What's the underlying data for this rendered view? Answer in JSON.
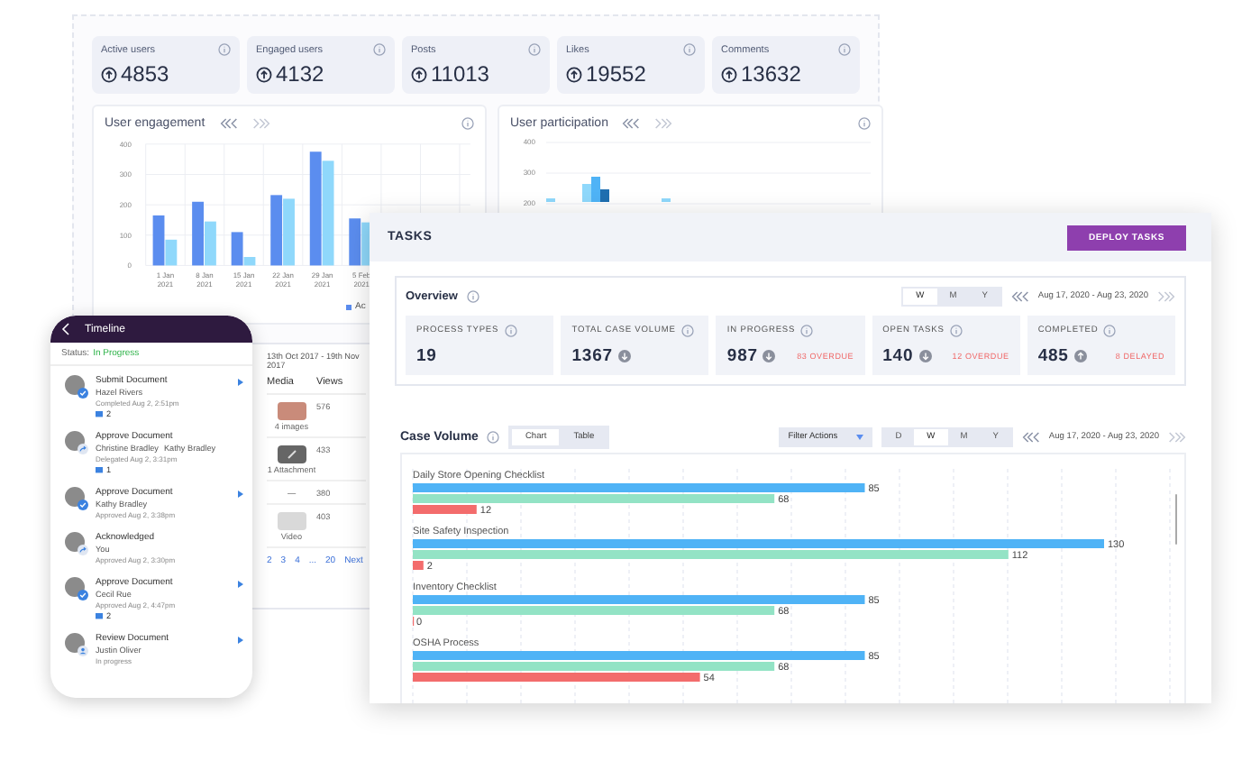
{
  "dashboard": {
    "stats": [
      {
        "label": "Active users",
        "value": "4853"
      },
      {
        "label": "Engaged users",
        "value": "4132"
      },
      {
        "label": "Posts",
        "value": "11013"
      },
      {
        "label": "Likes",
        "value": "19552"
      },
      {
        "label": "Comments",
        "value": "13632"
      }
    ],
    "engagement": {
      "title": "User engagement",
      "legend": "Ac",
      "chart_data": {
        "type": "bar",
        "categories": [
          "1 Jan 2021",
          "8 Jan 2021",
          "15 Jan 2021",
          "22 Jan 2021",
          "29 Jan 2021",
          "5 Feb 2021"
        ],
        "series": [
          {
            "color": "#5b8def",
            "values": [
              165,
              210,
              110,
              232,
              375,
              155
            ]
          },
          {
            "color": "#8fd8fb",
            "values": [
              85,
              145,
              28,
              220,
              345,
              142
            ]
          }
        ],
        "grid": true,
        "ylim": [
          0,
          400
        ],
        "yticks": [
          0,
          100,
          200,
          300,
          400
        ]
      }
    },
    "participation": {
      "title": "User participation",
      "ticks": [
        "400",
        "300",
        "200"
      ]
    }
  },
  "media_table": {
    "date_range": "13th Oct 2017 - 19th Nov 2017",
    "columns": [
      "Media",
      "Views"
    ],
    "rows": [
      {
        "kind": "images",
        "media": "4 images",
        "views": "576"
      },
      {
        "kind": "attachment",
        "media": "1 Attachment",
        "views": "433"
      },
      {
        "kind": "none",
        "media": "—",
        "views": "380"
      },
      {
        "kind": "video",
        "media": "Video",
        "views": "403"
      }
    ],
    "pages": [
      "2",
      "3",
      "4",
      "...",
      "20",
      "Next"
    ]
  },
  "phone": {
    "title": "Timeline",
    "status_label": "Status:",
    "status": "In Progress",
    "items": [
      {
        "kind": "check",
        "title": "Submit Document",
        "people": [
          "Hazel Rivers"
        ],
        "time": "Completed Aug 2, 2:51pm",
        "comments": "2",
        "action": true
      },
      {
        "kind": "forward",
        "title": "Approve Document",
        "people": [
          "Christine Bradley",
          "Kathy Bradley"
        ],
        "time": "Delegated Aug 2, 3:31pm",
        "comments": "1",
        "action": false
      },
      {
        "kind": "check",
        "title": "Approve Document",
        "people": [
          "Kathy Bradley"
        ],
        "time": "Approved Aug 2, 3:38pm",
        "action": true
      },
      {
        "kind": "forward",
        "title": "Acknowledged",
        "people": [
          "You"
        ],
        "time": "Approved Aug 2, 3:30pm",
        "action": false
      },
      {
        "kind": "check",
        "title": "Approve Document",
        "people": [
          "Cecil Rue"
        ],
        "time": "Approved Aug 2, 4:47pm",
        "comments": "2",
        "action": true
      },
      {
        "kind": "pending",
        "title": "Review Document",
        "people": [
          "Justin Oliver"
        ],
        "time": "In progress",
        "action": true
      }
    ]
  },
  "tasks": {
    "title": "TASKS",
    "deploy_button": "DEPLOY TASKS",
    "overview": {
      "title": "Overview",
      "periods": [
        {
          "label": "W",
          "selected": true
        },
        {
          "label": "M",
          "selected": false
        },
        {
          "label": "Y",
          "selected": false
        }
      ],
      "date_range": "Aug 17, 2020 - Aug 23, 2020",
      "stats": [
        {
          "label": "PROCESS TYPES",
          "value": "19"
        },
        {
          "label": "TOTAL CASE VOLUME",
          "value": "1367",
          "kind": "down"
        },
        {
          "label": "IN PROGRESS",
          "value": "987",
          "kind": "down",
          "note": "83 OVERDUE"
        },
        {
          "label": "OPEN TASKS",
          "value": "140",
          "kind": "down",
          "note": "12 OVERDUE"
        },
        {
          "label": "COMPLETED",
          "value": "485",
          "kind": "up",
          "note": "8 DELAYED"
        }
      ]
    },
    "case_volume": {
      "title": "Case Volume",
      "views": [
        {
          "label": "Chart",
          "selected": true
        },
        {
          "label": "Table",
          "selected": false
        }
      ],
      "filter": "Filter Actions",
      "periods": [
        {
          "label": "D",
          "selected": false
        },
        {
          "label": "W",
          "selected": true
        },
        {
          "label": "M",
          "selected": false
        },
        {
          "label": "Y",
          "selected": false
        }
      ],
      "date_range": "Aug 17, 2020 - Aug 23, 2020",
      "chart_data": {
        "type": "bar",
        "orientation": "horizontal",
        "data_labels": true,
        "categories": [
          "Daily Store Opening Checklist",
          "Site Safety Inspection",
          "Inventory Checklist",
          "OSHA Process"
        ],
        "series": [
          {
            "color": "#4fb3f6",
            "values": [
              85,
              130,
              85,
              85
            ]
          },
          {
            "color": "#93e3c5",
            "values": [
              68,
              112,
              68,
              68
            ]
          },
          {
            "color": "#f36c6c",
            "values": [
              12,
              2,
              0,
              54
            ]
          }
        ]
      }
    }
  }
}
